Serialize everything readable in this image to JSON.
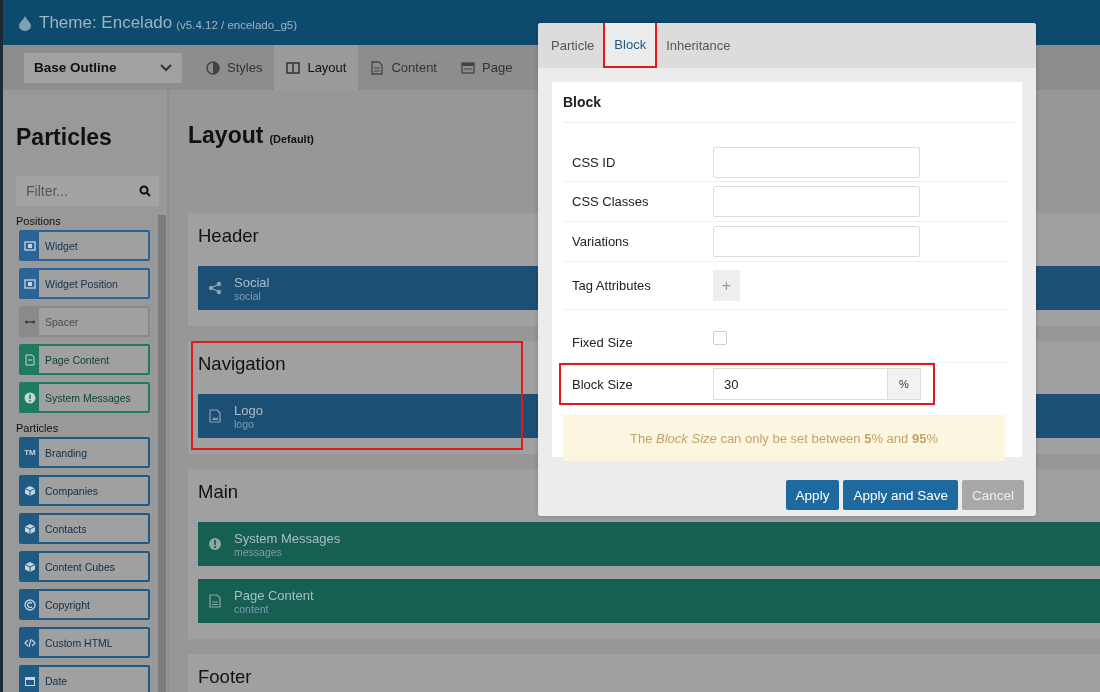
{
  "header": {
    "title": "Theme: Encelado",
    "version": "(v5.4.12 / encelado_g5)"
  },
  "toolbar": {
    "outline_select": {
      "value": "Base Outline"
    },
    "tabs": [
      {
        "label": "Styles",
        "selected": false
      },
      {
        "label": "Layout",
        "selected": true
      },
      {
        "label": "Content",
        "selected": false
      },
      {
        "label": "Page",
        "selected": false
      }
    ]
  },
  "sidebar": {
    "title": "Particles",
    "filter": {
      "placeholder": "Filter..."
    },
    "groups": [
      {
        "label": "Positions",
        "items": [
          {
            "name": "Widget",
            "color": "#2a6496"
          },
          {
            "name": "Widget Position",
            "color": "#2a6496"
          },
          {
            "name": "Spacer",
            "color": "#8a8a8a"
          },
          {
            "name": "Page Content",
            "color": "#1f7a62"
          },
          {
            "name": "System Messages",
            "color": "#1f7a62"
          }
        ]
      },
      {
        "label": "Particles",
        "items": [
          {
            "name": "Branding",
            "color": "#1f5a85",
            "icon_text": "TM"
          },
          {
            "name": "Companies",
            "color": "#1f5a85"
          },
          {
            "name": "Contacts",
            "color": "#1f5a85"
          },
          {
            "name": "Content Cubes",
            "color": "#1f5a85"
          },
          {
            "name": "Copyright",
            "color": "#1f5a85"
          },
          {
            "name": "Custom HTML",
            "color": "#1f5a85"
          },
          {
            "name": "Date",
            "color": "#1f5a85"
          }
        ]
      }
    ]
  },
  "layout": {
    "title": "Layout",
    "subtitle": "(Default)",
    "sections": [
      {
        "title": "Header",
        "highlighted": false,
        "blocks": [
          {
            "name": "Social",
            "type": "social",
            "color": "#1c4f74"
          }
        ]
      },
      {
        "title": "Navigation",
        "highlighted": true,
        "blocks": [
          {
            "name": "Logo",
            "type": "logo",
            "color": "#1c4f74"
          }
        ]
      },
      {
        "title": "Main",
        "highlighted": false,
        "blocks": [
          {
            "name": "System Messages",
            "type": "messages",
            "color": "#175f50"
          },
          {
            "name": "Page Content",
            "type": "content",
            "color": "#175f50"
          }
        ]
      },
      {
        "title": "Footer",
        "highlighted": false
      }
    ]
  },
  "modal": {
    "tabs": [
      {
        "label": "Particle",
        "selected": false,
        "highlighted": false
      },
      {
        "label": "Block",
        "selected": true,
        "highlighted": true
      },
      {
        "label": "Inheritance",
        "selected": false,
        "highlighted": false
      }
    ],
    "panel_title": "Block",
    "fields": [
      {
        "label": "CSS ID",
        "kind": "text",
        "highlighted": false
      },
      {
        "label": "CSS Classes",
        "kind": "text",
        "highlighted": false
      },
      {
        "label": "Variations",
        "kind": "text",
        "highlighted": false
      },
      {
        "label": "Tag Attributes",
        "kind": "add",
        "button": "+",
        "highlighted": false
      },
      {
        "label": "Fixed Size",
        "kind": "checkbox",
        "checked": false,
        "highlighted": false
      },
      {
        "label": "Block Size",
        "kind": "number",
        "value": "30",
        "unit": "%",
        "highlighted": true
      }
    ],
    "notice": "The *Block Size* can only be set between **5**% and **95**%",
    "buttons": [
      {
        "label": "Apply",
        "kind": "primary"
      },
      {
        "label": "Apply and Save",
        "kind": "primary"
      },
      {
        "label": "Cancel",
        "kind": "secondary"
      }
    ]
  }
}
